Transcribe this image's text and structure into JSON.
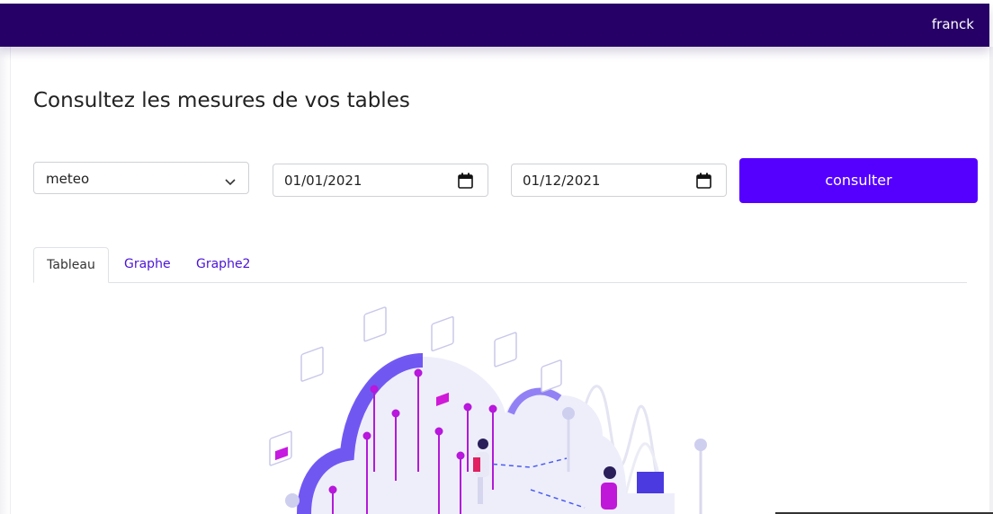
{
  "header": {
    "username": "franck"
  },
  "page": {
    "title": "Consultez les mesures de vos tables"
  },
  "filters": {
    "table_select": {
      "value": "meteo"
    },
    "start_date": {
      "value": "01/01/2021"
    },
    "end_date": {
      "value": "01/12/2021"
    },
    "submit_label": "consulter"
  },
  "tabs": [
    {
      "label": "Tableau",
      "active": true
    },
    {
      "label": "Graphe",
      "active": false
    },
    {
      "label": "Graphe2",
      "active": false
    }
  ],
  "colors": {
    "topbar": "#260067",
    "accent": "#5500ff",
    "tab_link": "#4a14d6"
  },
  "icons": {
    "select_arrow": "chevron-down-icon",
    "date_picker": "calendar-icon"
  }
}
